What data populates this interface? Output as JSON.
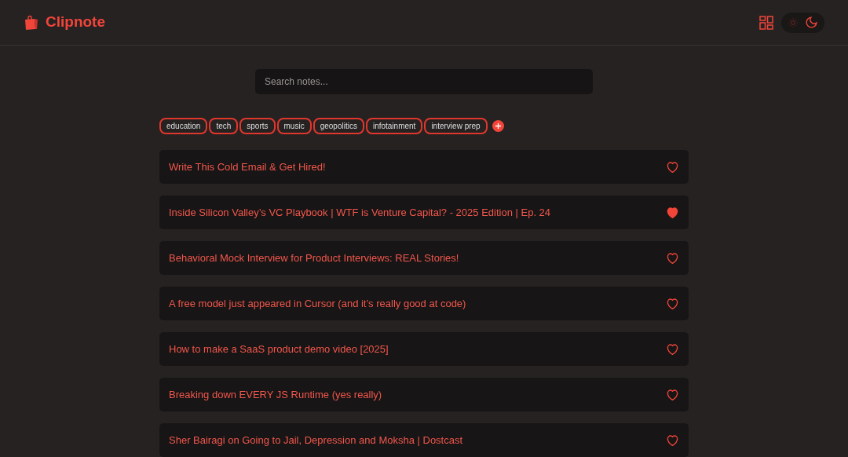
{
  "app": {
    "name": "Clipnote"
  },
  "theme_toggle": {
    "dark": true
  },
  "search": {
    "placeholder": "Search notes..."
  },
  "tags": [
    "education",
    "tech",
    "sports",
    "music",
    "geopolitics",
    "infotainment",
    "interview prep"
  ],
  "notes": [
    {
      "title": "Write This Cold Email & Get Hired!",
      "favorite": false
    },
    {
      "title": "Inside Silicon Valley’s VC Playbook | WTF is Venture Capital? - 2025 Edition | Ep. 24",
      "favorite": true
    },
    {
      "title": "Behavioral Mock Interview for Product Interviews: REAL Stories!",
      "favorite": false
    },
    {
      "title": "A free model just appeared in Cursor (and it’s really good at code)",
      "favorite": false
    },
    {
      "title": "How to make a SaaS product demo video [2025]",
      "favorite": false
    },
    {
      "title": "Breaking down EVERY JS Runtime (yes really)",
      "favorite": false
    },
    {
      "title": "Sher Bairagi on Going to Jail, Depression and Moksha | Dostcast",
      "favorite": false
    }
  ]
}
